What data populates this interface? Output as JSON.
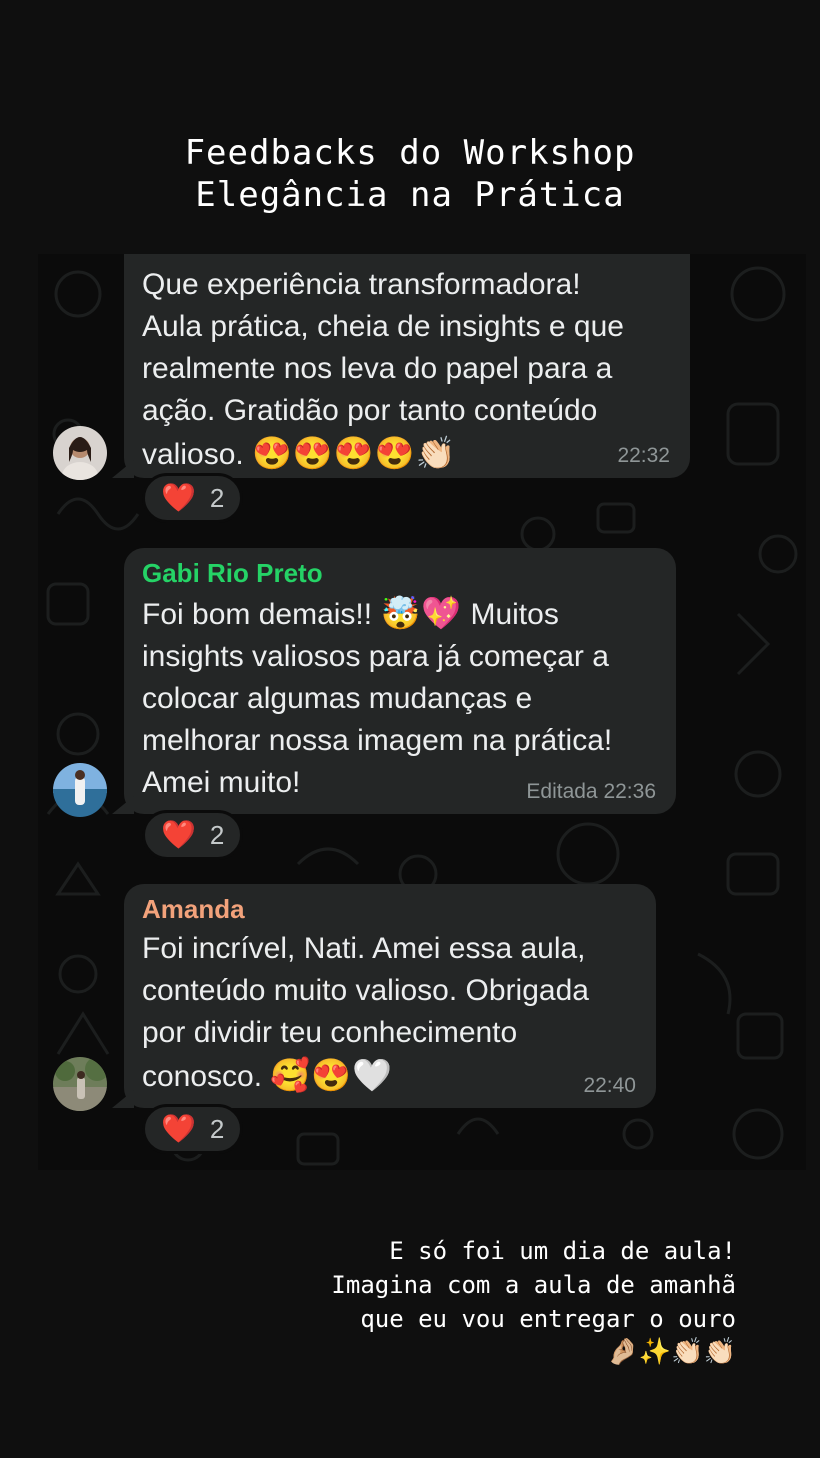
{
  "story": {
    "title": "Feedbacks do Workshop\nElegância na Prática",
    "caption": "E só foi um dia de aula!\nImagina com a aula de amanhã\nque eu vou entregar o ouro",
    "caption_emojis": "🤌🏼✨👏🏻👏🏻"
  },
  "colors": {
    "chat_background": "#0b0b0b",
    "bubble": "#242626",
    "sender_gabi": "#25d366",
    "sender_amanda": "#f2a27b",
    "timestamp": "#8f9697",
    "reaction_heart": "#e8223a"
  },
  "messages": [
    {
      "sender": "",
      "text": "Que experiência transformadora!\nAula prática, cheia de insights e que\nrealmente nos leva do papel para a\nação. Gratidão por tanto conteúdo\nvalioso.",
      "emojis": "😍😍😍😍👏🏻",
      "time": "22:32",
      "reaction": {
        "emoji": "❤️",
        "count": "2"
      },
      "avatar_icon": "avatar-woman-portrait"
    },
    {
      "sender": "Gabi Rio Preto",
      "text_line1": "Foi bom demais!!",
      "text_line1_emojis": "🤯💖",
      "text_line1_tail": "Muitos",
      "text": "insights valiosos para já começar a\ncolocar algumas mudanças e\nmelhorar nossa imagem na prática!\nAmei muito!",
      "time": "Editada 22:36",
      "reaction": {
        "emoji": "❤️",
        "count": "2"
      },
      "avatar_icon": "avatar-woman-lake"
    },
    {
      "sender": "Amanda",
      "text": "Foi incrível, Nati. Amei essa aula,\nconteúdo muito valioso. Obrigada\npor dividir teu conhecimento\nconosco.",
      "emojis": "🥰😍🤍",
      "time": "22:40",
      "reaction": {
        "emoji": "❤️",
        "count": "2"
      },
      "avatar_icon": "avatar-woman-garden"
    }
  ]
}
